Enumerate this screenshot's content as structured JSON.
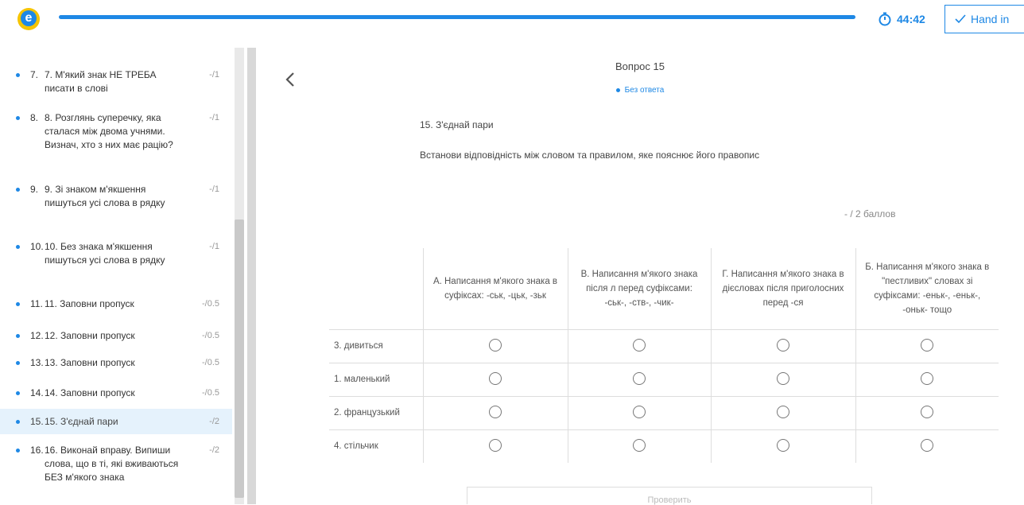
{
  "header": {
    "logo_letter": "e",
    "timer": "44:42",
    "hand_in_label": "Hand in",
    "progress_fraction": 1.0
  },
  "sidebar": {
    "items": [
      {
        "num": "7.",
        "text": "7. М'який знак НЕ ТРЕБА писати в слові",
        "score": "-/1"
      },
      {
        "num": "8.",
        "text": "8. Розглянь суперечку, яка сталася між двома учнями. Визнач, хто з них має рацію?",
        "score": "-/1"
      },
      {
        "num": "9.",
        "text": "9. Зі знаком м'якшення пишуться усі слова в рядку",
        "score": "-/1"
      },
      {
        "num": "10.",
        "text": "10. Без знака м'якшення пишуться усі слова в рядку",
        "score": "-/1"
      },
      {
        "num": "11.",
        "text": "11. Заповни пропуск",
        "score": "-/0.5"
      },
      {
        "num": "12.",
        "text": "12. Заповни пропуск",
        "score": "-/0.5"
      },
      {
        "num": "13.",
        "text": "13. Заповни пропуск",
        "score": "-/0.5"
      },
      {
        "num": "14.",
        "text": "14. Заповни пропуск",
        "score": "-/0.5"
      },
      {
        "num": "15.",
        "text": "15. З'єднай пари",
        "score": "-/2"
      },
      {
        "num": "16.",
        "text": "16. Виконай вправу. Випиши слова, що в ті, які вживаються БЕЗ м'якого знака",
        "score": "-/2"
      }
    ]
  },
  "question": {
    "title": "Вопрос 15",
    "status": "Без ответа",
    "name": "15. З'єднай пари",
    "instruction": "Встанови відповідність між словом та правилом, яке пояснює його правопис",
    "points": "- / 2  баллов",
    "columns": [
      "А. Написання м'якого знака в суфіксах: -ськ, -цьк, -зьк",
      "В. Написання м'якого знака після л перед суфіксами: -ськ-, -ств-, -чик-",
      "Г. Написання м'якого знака в дієсловах після приголосних перед -ся",
      "Б. Написання м'якого знака в \"пестливих\" словах зі суфіксами: -еньк-, -еньк-, -оньк- тощо"
    ],
    "rows": [
      "3. дивиться",
      "1. маленький",
      "2. французький",
      "4. стільчик"
    ],
    "bottom_label": "Проверить"
  }
}
